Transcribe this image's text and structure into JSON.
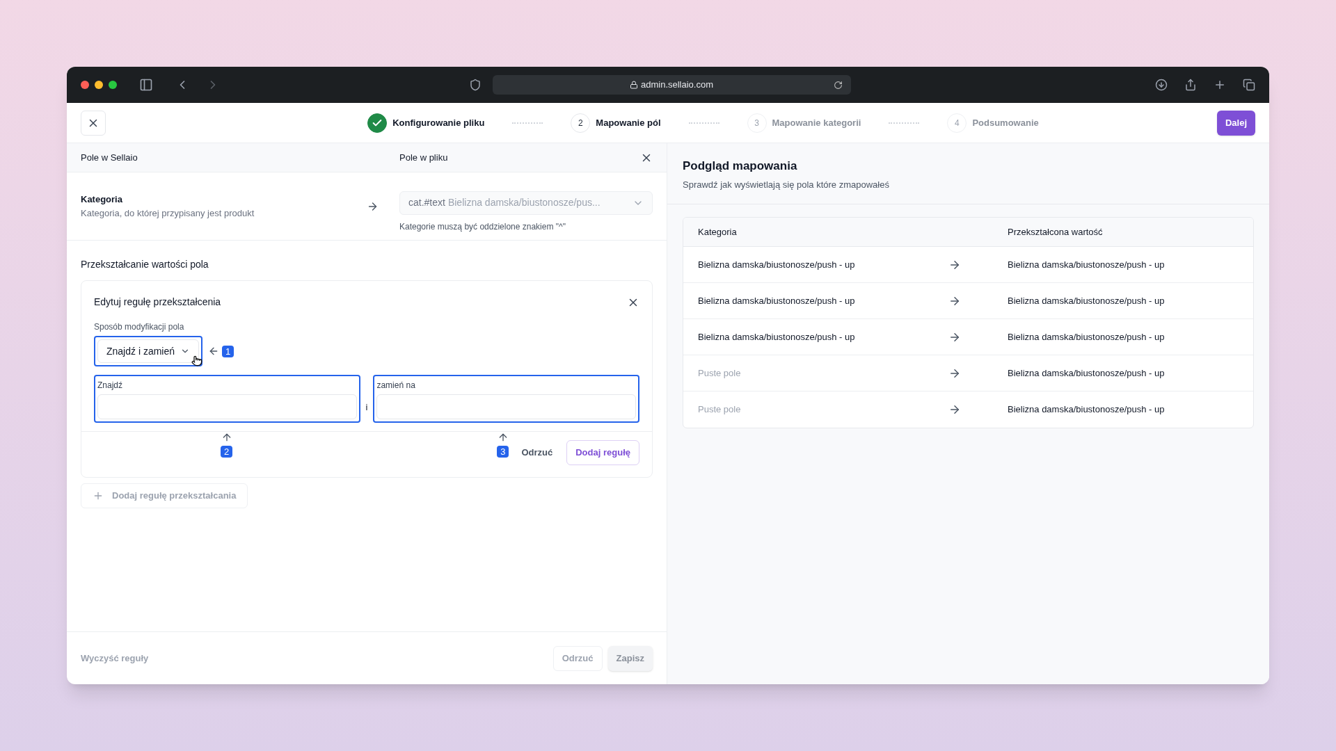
{
  "browser": {
    "url": "admin.sellaio.com"
  },
  "header": {
    "steps": [
      {
        "label": "Konfigurowanie pliku",
        "kind": "done"
      },
      {
        "number": "2",
        "label": "Mapowanie pól",
        "kind": "current"
      },
      {
        "number": "3",
        "label": "Mapowanie kategorii",
        "kind": "pending"
      },
      {
        "number": "4",
        "label": "Podsumowanie",
        "kind": "pending"
      }
    ],
    "next_button": "Dalej"
  },
  "editor": {
    "columns": [
      "Pole w Sellaio",
      "Pole w pliku"
    ],
    "field": {
      "name": "Kategoria",
      "description": "Kategoria, do której przypisany jest produkt",
      "source_tag": "cat.#text",
      "source_sample": "Bielizna damska/biustonosze/pus...",
      "hint": "Kategorie muszą być oddzielone znakiem \"^\""
    },
    "section_title": "Przekształcanie wartości pola",
    "rule": {
      "title": "Edytuj regułę przekształcenia",
      "mode_label": "Sposób modyfikacji pola",
      "mode_value": "Znajdź i zamień",
      "find_label": "Znajdź",
      "joiner": "i",
      "replace_label": "zamień na",
      "discard": "Odrzuć",
      "add": "Dodaj regułę"
    },
    "callouts": [
      "1",
      "2",
      "3"
    ],
    "add_rule": {
      "label": "Dodaj regułę przekształcania",
      "disabled": true
    },
    "footer": {
      "clear": {
        "label": "Wyczyść reguły",
        "disabled": true
      },
      "discard": {
        "label": "Odrzuć",
        "disabled": true
      },
      "save": {
        "label": "Zapisz",
        "disabled": true
      }
    }
  },
  "preview": {
    "title": "Podgląd mapowania",
    "subtitle": "Sprawdź jak wyświetlają się pola które zmapowałeś",
    "columns": [
      "Kategoria",
      "Przekształcona wartość"
    ],
    "rows": [
      {
        "source": "Bielizna damska/biustonosze/push - up",
        "empty": false,
        "result": "Bielizna damska/biustonosze/push - up"
      },
      {
        "source": "Bielizna damska/biustonosze/push - up",
        "empty": false,
        "result": "Bielizna damska/biustonosze/push - up"
      },
      {
        "source": "Bielizna damska/biustonosze/push - up",
        "empty": false,
        "result": "Bielizna damska/biustonosze/push - up"
      },
      {
        "source": "Puste pole",
        "empty": true,
        "result": "Bielizna damska/biustonosze/push - up"
      },
      {
        "source": "Puste pole",
        "empty": true,
        "result": "Bielizna damska/biustonosze/push - up"
      }
    ]
  }
}
